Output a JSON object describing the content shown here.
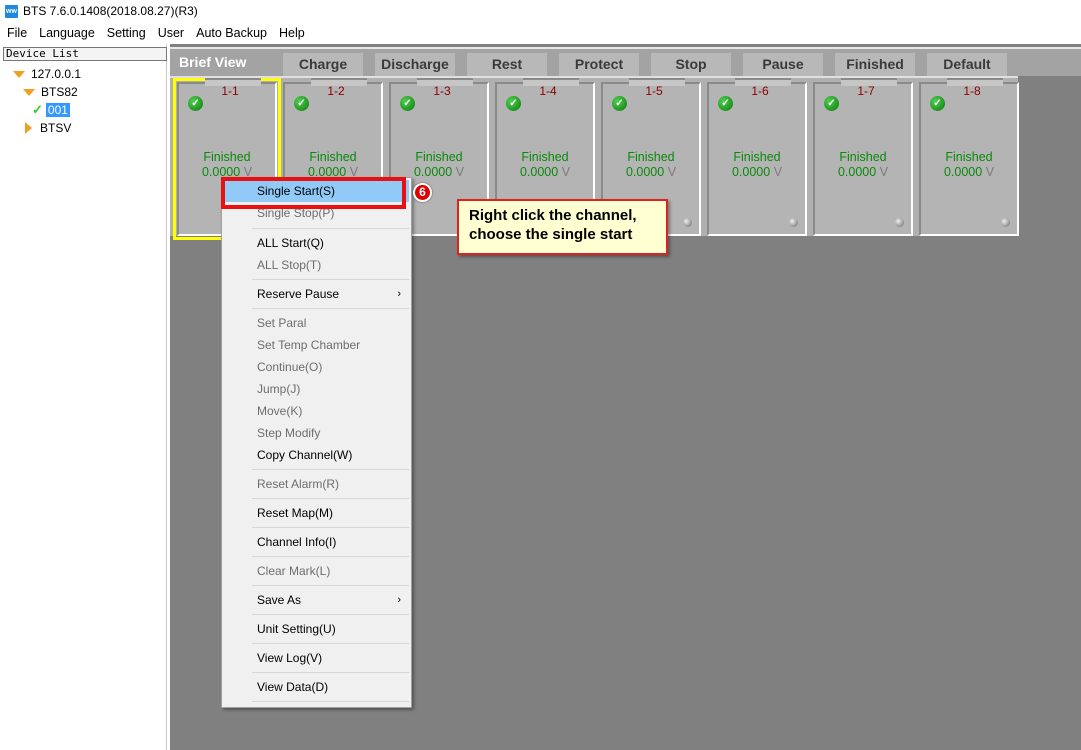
{
  "window": {
    "title": "BTS 7.6.0.1408(2018.08.27)(R3)",
    "icon": "app-icon"
  },
  "menubar": [
    "File",
    "Language",
    "Setting",
    "User",
    "Auto Backup",
    "Help"
  ],
  "sidebar": {
    "header": "Device List",
    "tree": [
      {
        "label": "127.0.0.1",
        "state": "expanded"
      },
      {
        "label": "BTS82",
        "state": "expanded"
      },
      {
        "label": "001",
        "state": "selected",
        "icon": "check-icon"
      },
      {
        "label": "BTSV",
        "state": "collapsed"
      }
    ]
  },
  "tabs": {
    "active": "Brief View",
    "items": [
      "Charge",
      "Discharge",
      "Rest",
      "Protect",
      "Stop",
      "Pause",
      "Finished",
      "Default"
    ]
  },
  "channels": [
    {
      "id": "1-1",
      "status": "Finished",
      "voltage": "0.0000",
      "unit": "V",
      "selected": true
    },
    {
      "id": "1-2",
      "status": "Finished",
      "voltage": "0.0000",
      "unit": "V"
    },
    {
      "id": "1-3",
      "status": "Finished",
      "voltage": "0.0000",
      "unit": "V"
    },
    {
      "id": "1-4",
      "status": "Finished",
      "voltage": "0.0000",
      "unit": "V"
    },
    {
      "id": "1-5",
      "status": "Finished",
      "voltage": "0.0000",
      "unit": "V"
    },
    {
      "id": "1-6",
      "status": "Finished",
      "voltage": "0.0000",
      "unit": "V"
    },
    {
      "id": "1-7",
      "status": "Finished",
      "voltage": "0.0000",
      "unit": "V"
    },
    {
      "id": "1-8",
      "status": "Finished",
      "voltage": "0.0000",
      "unit": "V"
    }
  ],
  "context_menu": {
    "items": [
      {
        "label": "Single Start(S)",
        "enabled": true,
        "highlighted": true
      },
      {
        "label": "Single Stop(P)",
        "enabled": false
      },
      {
        "label": "ALL Start(Q)",
        "enabled": true
      },
      {
        "label": "ALL Stop(T)",
        "enabled": false
      },
      {
        "label": "Reserve Pause",
        "enabled": true,
        "submenu": true
      },
      {
        "label": "Set Paral",
        "enabled": false
      },
      {
        "label": "Set Temp Chamber",
        "enabled": false
      },
      {
        "label": "Continue(O)",
        "enabled": false
      },
      {
        "label": "Jump(J)",
        "enabled": false
      },
      {
        "label": "Move(K)",
        "enabled": false
      },
      {
        "label": "Step Modify",
        "enabled": false
      },
      {
        "label": "Copy Channel(W)",
        "enabled": true
      },
      {
        "label": "Reset Alarm(R)",
        "enabled": false
      },
      {
        "label": "Reset Map(M)",
        "enabled": true
      },
      {
        "label": "Channel Info(I)",
        "enabled": true
      },
      {
        "label": "Clear Mark(L)",
        "enabled": false
      },
      {
        "label": "Save As",
        "enabled": true,
        "submenu": true
      },
      {
        "label": "Unit Setting(U)",
        "enabled": true
      },
      {
        "label": "View Log(V)",
        "enabled": true
      },
      {
        "label": "View Data(D)",
        "enabled": true
      }
    ],
    "submenu_arrow": "›"
  },
  "annotation": {
    "step_number": "6",
    "callout_line1": "Right click the channel,",
    "callout_line2": "choose the single start"
  }
}
